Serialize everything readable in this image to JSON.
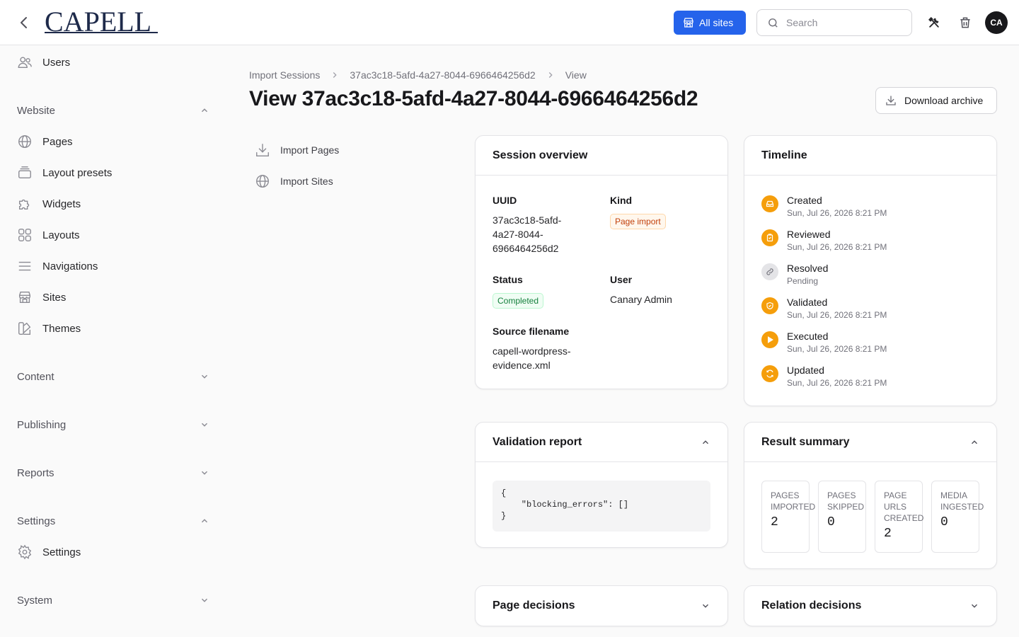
{
  "topbar": {
    "logo_text": "CAPELL",
    "all_sites_label": "All sites",
    "search_placeholder": "Search",
    "avatar_initials": "CA"
  },
  "sidebar": {
    "top_item": {
      "label": "Users",
      "icon": "users-icon"
    },
    "groups": {
      "website": {
        "label": "Website",
        "expanded": true
      },
      "content": {
        "label": "Content",
        "expanded": false
      },
      "publishing": {
        "label": "Publishing",
        "expanded": false
      },
      "reports": {
        "label": "Reports",
        "expanded": false
      },
      "settings": {
        "label": "Settings",
        "expanded": true
      },
      "system": {
        "label": "System",
        "expanded": false
      }
    },
    "website_items": [
      {
        "label": "Pages",
        "icon": "globe-icon"
      },
      {
        "label": "Layout presets",
        "icon": "stack-icon"
      },
      {
        "label": "Widgets",
        "icon": "puzzle-icon"
      },
      {
        "label": "Layouts",
        "icon": "grid-icon"
      },
      {
        "label": "Navigations",
        "icon": "menu-lines-icon"
      },
      {
        "label": "Sites",
        "icon": "storefront-icon"
      },
      {
        "label": "Themes",
        "icon": "swatch-icon"
      }
    ],
    "settings_items": [
      {
        "label": "Settings",
        "icon": "gear-icon"
      }
    ]
  },
  "breadcrumb": [
    "Import Sessions",
    "37ac3c18-5afd-4a27-8044-6966464256d2",
    "View"
  ],
  "page_title": "View 37ac3c18-5afd-4a27-8044-6966464256d2",
  "download_label": "Download archive",
  "subnav": [
    {
      "label": "Import Pages",
      "icon": "download-icon"
    },
    {
      "label": "Import Sites",
      "icon": "globe-icon"
    }
  ],
  "session_overview": {
    "title": "Session overview",
    "uuid_label": "UUID",
    "uuid_lines": [
      "37ac3c18-5afd-",
      "4a27-8044-",
      "6966464256d2"
    ],
    "kind_label": "Kind",
    "kind_value": "Page import",
    "status_label": "Status",
    "status_value": "Completed",
    "user_label": "User",
    "user_value": "Canary Admin",
    "source_label": "Source filename",
    "source_lines": [
      "capell-wordpress-",
      "evidence.xml"
    ]
  },
  "timeline": {
    "title": "Timeline",
    "items": [
      {
        "title": "Created",
        "time": "Sun, Jul 26, 2026 8:21 PM",
        "status": "done",
        "icon": "inbox-icon"
      },
      {
        "title": "Reviewed",
        "time": "Sun, Jul 26, 2026 8:21 PM",
        "status": "done",
        "icon": "clipboard-icon"
      },
      {
        "title": "Resolved",
        "time": "Pending",
        "status": "pending",
        "icon": "link-icon"
      },
      {
        "title": "Validated",
        "time": "Sun, Jul 26, 2026 8:21 PM",
        "status": "done",
        "icon": "shield-icon"
      },
      {
        "title": "Executed",
        "time": "Sun, Jul 26, 2026 8:21 PM",
        "status": "done",
        "icon": "play-icon"
      },
      {
        "title": "Updated",
        "time": "Sun, Jul 26, 2026 8:21 PM",
        "status": "done",
        "icon": "refresh-icon"
      }
    ],
    "colors": {
      "done": "#f59e0b",
      "pending": "#e4e4e7"
    }
  },
  "validation_report": {
    "title": "Validation report",
    "code": "{\n    \"blocking_errors\": []\n}"
  },
  "result_summary": {
    "title": "Result summary",
    "stats": [
      {
        "label": "Pages imported",
        "value": "2"
      },
      {
        "label": "Pages skipped",
        "value": "0"
      },
      {
        "label": "Page URLs created",
        "value": "2"
      },
      {
        "label": "Media ingested",
        "value": "0"
      }
    ]
  },
  "page_decisions": {
    "title": "Page decisions"
  },
  "relation_decisions": {
    "title": "Relation decisions"
  },
  "colors": {
    "primary": "#2563eb",
    "timeline_accent": "#f59e0b",
    "avatar_bg": "#18181b"
  }
}
